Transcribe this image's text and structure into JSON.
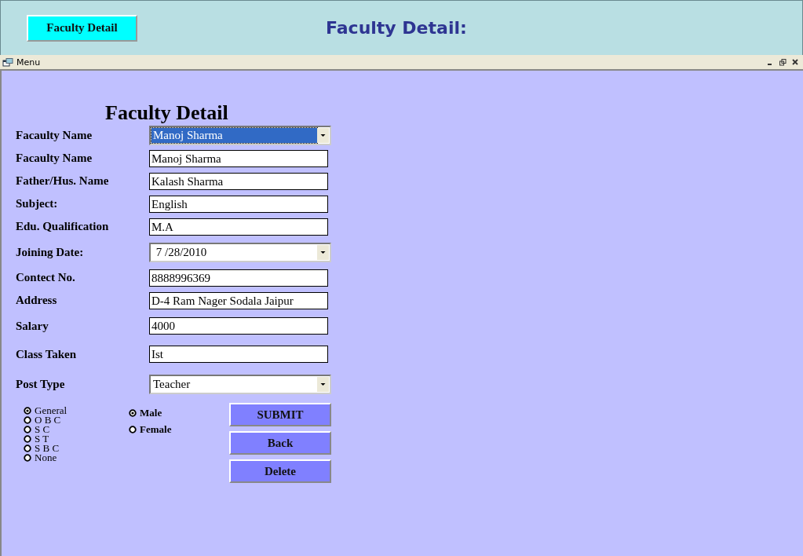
{
  "header": {
    "button": "Faculty Detail",
    "title": "Faculty Detail:"
  },
  "menu_bar": {
    "title": "Menu"
  },
  "form": {
    "title": "Faculty Detail",
    "fields": [
      {
        "label": "Facaulty Name",
        "kind": "combo",
        "value": "Manoj Sharma",
        "selected": true
      },
      {
        "label": "Facaulty Name",
        "kind": "text",
        "value": "Manoj Sharma"
      },
      {
        "label": "Father/Hus. Name",
        "kind": "text",
        "value": "Kalash Sharma"
      },
      {
        "label": "Subject:",
        "kind": "text",
        "value": "English"
      },
      {
        "label": "Edu. Qualification",
        "kind": "text",
        "value": "M.A"
      },
      {
        "label": "Joining Date:",
        "kind": "combo",
        "value": " 7 /28/2010",
        "selected": false
      },
      {
        "label": "Contect No.",
        "kind": "text",
        "value": "8888996369"
      },
      {
        "label": "Address",
        "kind": "text",
        "value": "D-4 Ram Nager Sodala Jaipur"
      },
      {
        "label": "Salary",
        "kind": "text",
        "value": "4000"
      },
      {
        "label": "Class Taken",
        "kind": "text",
        "value": "Ist"
      },
      {
        "label": "Post Type",
        "kind": "combo",
        "value": "Teacher",
        "selected": false
      }
    ],
    "category": [
      {
        "label": "General",
        "selected": true
      },
      {
        "label": "O B C",
        "selected": false
      },
      {
        "label": "S C",
        "selected": false
      },
      {
        "label": "S T",
        "selected": false
      },
      {
        "label": "S B C",
        "selected": false
      },
      {
        "label": "None",
        "selected": false
      }
    ],
    "gender": [
      {
        "label": "Male",
        "selected": true
      },
      {
        "label": "Female",
        "selected": false
      }
    ],
    "buttons": [
      "SUBMIT",
      "Back",
      "Delete"
    ]
  }
}
